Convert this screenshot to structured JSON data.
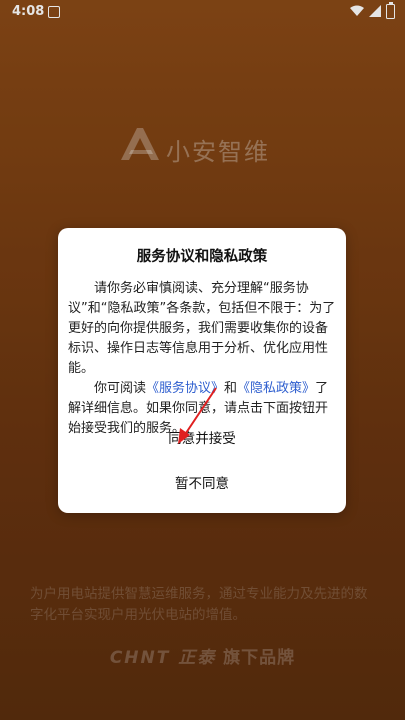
{
  "status_bar": {
    "time": "4:08",
    "icons": [
      "notification-a-icon",
      "wifi-icon",
      "signal-icon",
      "battery-charging-icon"
    ]
  },
  "background": {
    "brand_name": "小安智维",
    "tagline": "为户用电站提供智慧运维服务，通过专业能力及先进的数字化平台实现户用光伏电站的增值。",
    "footer_brand": "CHNT 正泰",
    "footer_suffix": " 旗下品牌"
  },
  "dialog": {
    "title": "服务协议和隐私政策",
    "paragraph1": "请你务必审慎阅读、充分理解“服务协议”和“隐私政策”各条款，包括但不限于：为了更好的向你提供服务，我们需要收集你的设备标识、操作日志等信息用于分析、优化应用性能。",
    "p2_prefix": "你可阅读",
    "link_service": "《服务协议》",
    "p2_and": "和",
    "link_privacy": "《隐私政策》",
    "p2_suffix": "了解详细信息。如果你同意，请点击下面按钮开始接受我们的服务。",
    "agree_label": "同意并接受",
    "disagree_label": "暂不同意"
  },
  "colors": {
    "link": "#2f5fcf",
    "annotation_arrow": "#e02020"
  }
}
